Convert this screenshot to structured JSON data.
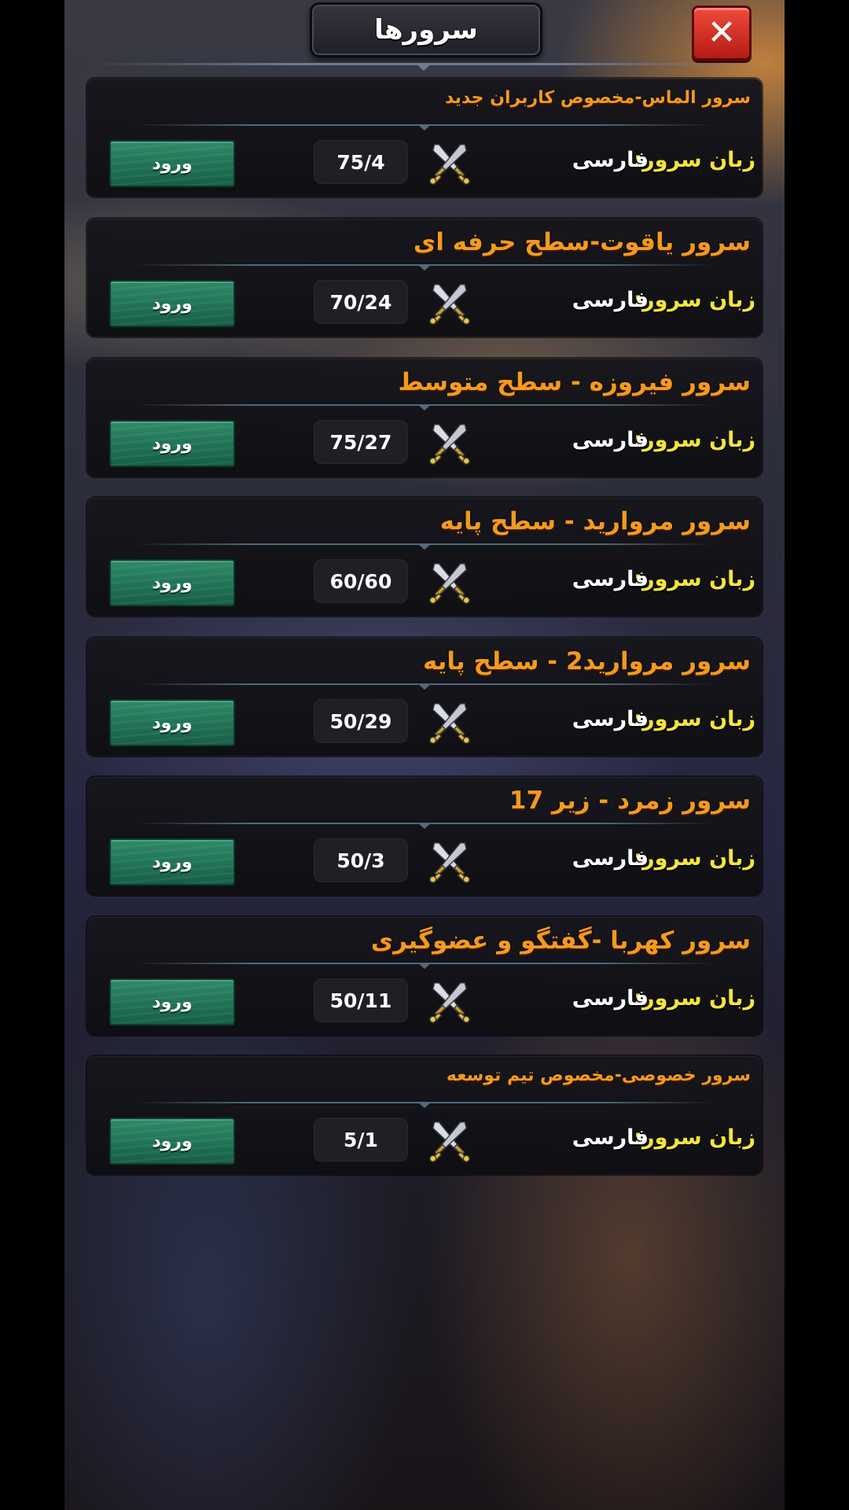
{
  "header": {
    "title": "سرورها",
    "close_label": "✕"
  },
  "servers": [
    {
      "name": "سرور الماس-مخصوص کاربران جدید",
      "language_label": "زبان سرور:",
      "language": "فارسی",
      "players": "75/4",
      "enter_label": "ورود"
    },
    {
      "name": "سرور یاقوت-سطح حرفه ای",
      "language_label": "زبان سرور:",
      "language": "فارسی",
      "players": "70/24",
      "enter_label": "ورود"
    },
    {
      "name": "سرور فیروزه - سطح متوسط",
      "language_label": "زبان سرور:",
      "language": "فارسی",
      "players": "75/27",
      "enter_label": "ورود"
    },
    {
      "name": "سرور مروارید - سطح پایه",
      "language_label": "زبان سرور:",
      "language": "فارسی",
      "players": "60/60",
      "enter_label": "ورود"
    },
    {
      "name": "سرور مروارید2 - سطح پایه",
      "language_label": "زبان سرور:",
      "language": "فارسی",
      "players": "50/29",
      "enter_label": "ورود"
    },
    {
      "name": "سرور زمرد - زیر 17",
      "language_label": "زبان سرور:",
      "language": "فارسی",
      "players": "50/3",
      "enter_label": "ورود"
    },
    {
      "name": "سرور کهربا -گفتگو و عضوگیری",
      "language_label": "زبان سرور:",
      "language": "فارسی",
      "players": "50/11",
      "enter_label": "ورود"
    },
    {
      "name": "سرور خصوصی-مخصوص تیم توسعه",
      "language_label": "زبان سرور:",
      "language": "فارسی",
      "players": "5/1",
      "enter_label": "ورود"
    }
  ],
  "icons": {
    "close": "close-icon",
    "players": "crossed-swords-icon"
  },
  "colors": {
    "server_name": "#f49a1d",
    "language_label": "#f5e53a",
    "enter_button": "#1f7a58",
    "close_button": "#d8322a"
  }
}
